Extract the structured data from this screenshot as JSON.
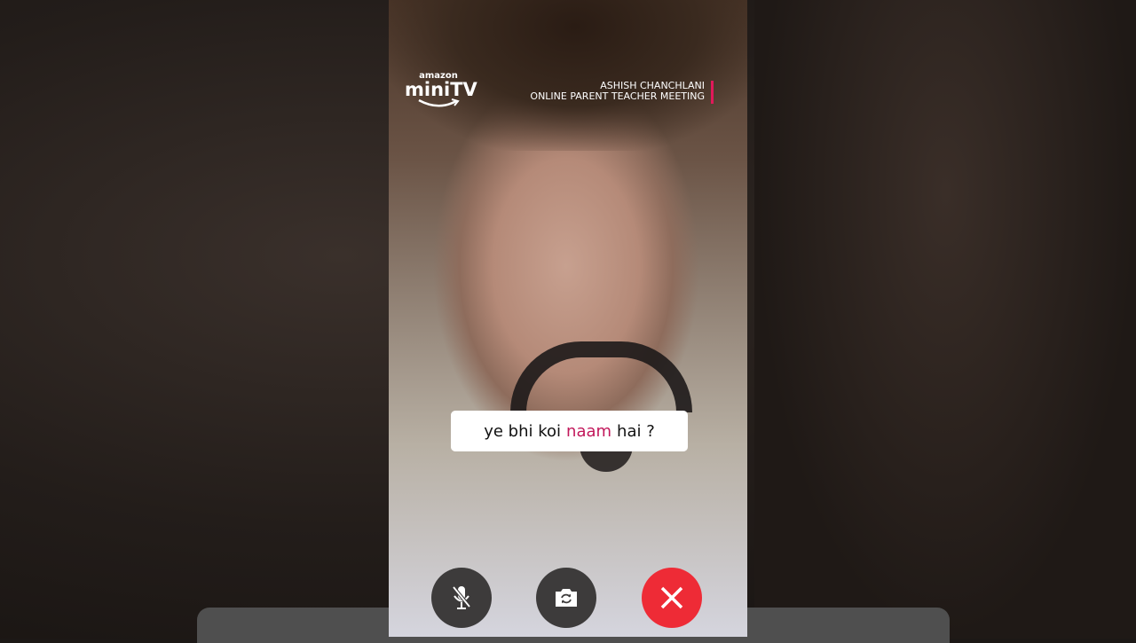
{
  "branding": {
    "amazon": "amazon",
    "product": "miniTV"
  },
  "video_title": {
    "line1": "ASHISH CHANCHLANI",
    "line2": "ONLINE PARENT TEACHER MEETING"
  },
  "caption": {
    "before": "ye bhi koi",
    "highlight": "naam",
    "after": "hai ?"
  },
  "controls": {
    "mute_icon": "mic-off-icon",
    "flip_icon": "camera-flip-icon",
    "end_icon": "close-icon"
  },
  "colors": {
    "accent": "#e0195a",
    "end_call": "#ee2b36"
  }
}
